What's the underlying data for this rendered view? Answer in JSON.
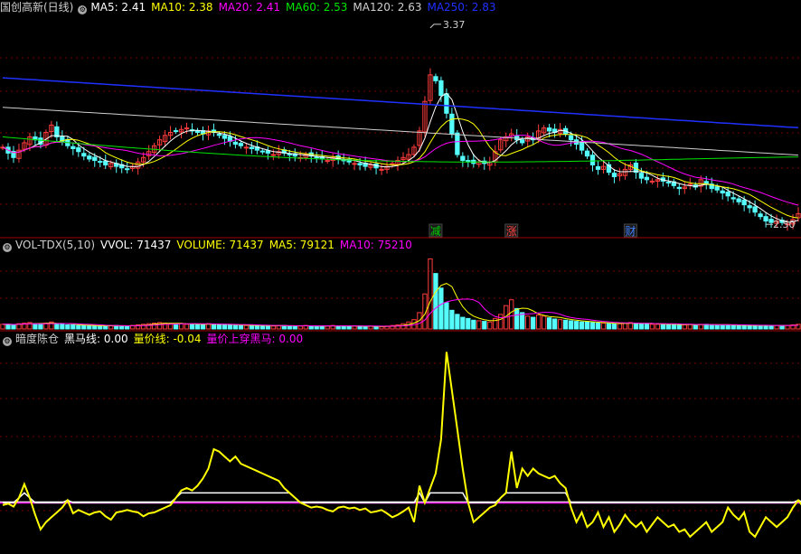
{
  "colors": {
    "up": "#ff3c3c",
    "down": "#54fcfc",
    "ma5": "#ffffff",
    "ma10": "#ffff00",
    "ma20": "#ff00ff",
    "ma60": "#00e600",
    "ma120": "#cfcfcf",
    "ma250": "#2030ff",
    "grid": "#7a0000",
    "separator": "#a00000",
    "heima": "#ffff00",
    "liangjia": "#ffffff",
    "chuan": "#ff00ff"
  },
  "panel1": {
    "title": "国创高新(日线)",
    "ma_labels": [
      {
        "name": "MA5:",
        "value": "2.41",
        "color": "#ffffff"
      },
      {
        "name": "MA10:",
        "value": "2.38",
        "color": "#ffff00"
      },
      {
        "name": "MA20:",
        "value": "2.41",
        "color": "#ff00ff"
      },
      {
        "name": "MA60:",
        "value": "2.53",
        "color": "#00e600"
      },
      {
        "name": "MA120:",
        "value": "2.63",
        "color": "#cfcfcf"
      },
      {
        "name": "MA250:",
        "value": "2.83",
        "color": "#2030ff"
      }
    ],
    "high_label": "3.37",
    "low_label": "2.50",
    "markers": [
      {
        "text": "减",
        "index": 80,
        "color": "#00d000"
      },
      {
        "text": "涨",
        "index": 94,
        "color": "#ff4040"
      },
      {
        "text": "财",
        "index": 116,
        "color": "#4080ff"
      }
    ]
  },
  "panel2": {
    "title": "VOL-TDX(5,10)",
    "labels": [
      {
        "name": "VVOL:",
        "value": "71437",
        "color": "#ffffff"
      },
      {
        "name": "VOLUME:",
        "value": "71437",
        "color": "#ffff00"
      },
      {
        "name": "MA5:",
        "value": "79121",
        "color": "#ffff00"
      },
      {
        "name": "MA10:",
        "value": "75210",
        "color": "#ff00ff"
      }
    ]
  },
  "panel3": {
    "title": "暗度陈仓",
    "labels": [
      {
        "name": "黑马线:",
        "value": "0.00",
        "color": "#ffffff"
      },
      {
        "name": "量价线:",
        "value": "-0.04",
        "color": "#ffff00"
      },
      {
        "name": "量价上穿黑马:",
        "value": "0.00",
        "color": "#ff00ff"
      }
    ]
  },
  "chart_data": {
    "type": "candlestick",
    "count": 148,
    "candle_closes": [
      2.55,
      2.51,
      2.48,
      2.53,
      2.58,
      2.62,
      2.6,
      2.57,
      2.65,
      2.7,
      2.62,
      2.59,
      2.56,
      2.54,
      2.52,
      2.49,
      2.47,
      2.46,
      2.45,
      2.43,
      2.44,
      2.42,
      2.41,
      2.4,
      2.42,
      2.45,
      2.48,
      2.52,
      2.56,
      2.6,
      2.63,
      2.65,
      2.66,
      2.67,
      2.68,
      2.66,
      2.65,
      2.64,
      2.66,
      2.65,
      2.63,
      2.61,
      2.59,
      2.57,
      2.56,
      2.55,
      2.54,
      2.53,
      2.52,
      2.51,
      2.5,
      2.52,
      2.51,
      2.5,
      2.49,
      2.48,
      2.5,
      2.49,
      2.48,
      2.47,
      2.46,
      2.48,
      2.47,
      2.46,
      2.45,
      2.44,
      2.43,
      2.42,
      2.43,
      2.41,
      2.4,
      2.42,
      2.44,
      2.46,
      2.48,
      2.5,
      2.55,
      2.66,
      2.86,
      3.04,
      3.0,
      2.9,
      2.78,
      2.64,
      2.5,
      2.46,
      2.45,
      2.44,
      2.45,
      2.44,
      2.45,
      2.52,
      2.6,
      2.62,
      2.64,
      2.6,
      2.58,
      2.62,
      2.6,
      2.66,
      2.68,
      2.66,
      2.65,
      2.67,
      2.64,
      2.6,
      2.57,
      2.53,
      2.49,
      2.43,
      2.4,
      2.42,
      2.38,
      2.35,
      2.37,
      2.4,
      2.43,
      2.38,
      2.34,
      2.33,
      2.32,
      2.33,
      2.32,
      2.31,
      2.29,
      2.27,
      2.28,
      2.3,
      2.28,
      2.33,
      2.3,
      2.27,
      2.26,
      2.24,
      2.22,
      2.2,
      2.18,
      2.16,
      2.14,
      2.11,
      2.08,
      2.05,
      2.04,
      2.05,
      2.04,
      2.03,
      2.06,
      2.1
    ],
    "volume": [
      8,
      8,
      7,
      9,
      10,
      11,
      9,
      8,
      10,
      12,
      9,
      8,
      7,
      7,
      6,
      6,
      6,
      5,
      5,
      5,
      6,
      6,
      5,
      5,
      6,
      7,
      8,
      9,
      10,
      11,
      10,
      9,
      9,
      9,
      8,
      8,
      8,
      8,
      9,
      8,
      8,
      7,
      7,
      7,
      6,
      6,
      6,
      6,
      6,
      5,
      5,
      6,
      6,
      5,
      5,
      5,
      6,
      5,
      5,
      5,
      5,
      6,
      5,
      5,
      5,
      5,
      5,
      4,
      5,
      4,
      4,
      5,
      6,
      7,
      9,
      12,
      16,
      28,
      60,
      120,
      95,
      70,
      45,
      32,
      25,
      20,
      18,
      15,
      14,
      13,
      12,
      18,
      25,
      40,
      50,
      35,
      28,
      22,
      20,
      24,
      22,
      19,
      17,
      16,
      15,
      14,
      13,
      12,
      12,
      11,
      10,
      10,
      9,
      9,
      9,
      10,
      11,
      10,
      9,
      9,
      8,
      8,
      8,
      8,
      8,
      7,
      7,
      8,
      7,
      8,
      8,
      7,
      7,
      7,
      7,
      6,
      6,
      6,
      6,
      6,
      6,
      6,
      6,
      6,
      6,
      6,
      7,
      8
    ],
    "volume_max": 130,
    "heima_line": [
      0.0,
      "flat baseline"
    ],
    "liangjia_line": [
      -0.05,
      -0.02,
      -0.08,
      0.1,
      0.38,
      0.1,
      -0.25,
      -0.55,
      -0.4,
      -0.3,
      -0.2,
      -0.1,
      0.05,
      -0.22,
      -0.15,
      -0.2,
      -0.25,
      -0.2,
      -0.18,
      -0.28,
      -0.35,
      -0.2,
      -0.18,
      -0.15,
      -0.18,
      -0.2,
      -0.28,
      -0.22,
      -0.2,
      -0.15,
      -0.1,
      -0.05,
      0.1,
      0.25,
      0.3,
      0.25,
      0.35,
      0.5,
      0.7,
      1.1,
      1.05,
      0.95,
      0.85,
      0.95,
      0.8,
      0.75,
      0.7,
      0.65,
      0.6,
      0.55,
      0.5,
      0.45,
      0.3,
      0.2,
      0.1,
      0.0,
      -0.05,
      -0.1,
      -0.08,
      -0.1,
      -0.15,
      -0.18,
      -0.1,
      -0.08,
      -0.12,
      -0.1,
      -0.15,
      -0.12,
      -0.2,
      -0.18,
      -0.15,
      -0.22,
      -0.3,
      -0.25,
      -0.18,
      -0.1,
      -0.4,
      0.35,
      0.0,
      0.3,
      0.6,
      1.3,
      3.1,
      2.3,
      1.5,
      0.7,
      0.0,
      -0.4,
      -0.3,
      -0.2,
      -0.1,
      -0.05,
      0.1,
      0.2,
      1.05,
      0.3,
      0.7,
      0.55,
      0.7,
      0.6,
      0.55,
      0.5,
      0.55,
      0.4,
      0.3,
      -0.1,
      -0.4,
      -0.2,
      -0.5,
      -0.4,
      -0.2,
      -0.5,
      -0.3,
      -0.6,
      -0.45,
      -0.25,
      -0.4,
      -0.5,
      -0.4,
      -0.6,
      -0.45,
      -0.3,
      -0.4,
      -0.5,
      -0.45,
      -0.6,
      -0.55,
      -0.7,
      -0.6,
      -0.5,
      -0.4,
      -0.6,
      -0.5,
      -0.4,
      -0.1,
      -0.25,
      -0.35,
      -0.2,
      -0.6,
      -0.7,
      -0.5,
      -0.3,
      -0.4,
      -0.5,
      -0.4,
      -0.3,
      -0.1,
      0.05,
      -0.1,
      -0.2
    ]
  }
}
